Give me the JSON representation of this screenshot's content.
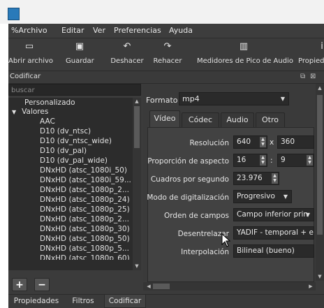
{
  "menubar": {
    "items": [
      {
        "label": "%Archivo"
      },
      {
        "label": "Editar"
      },
      {
        "label": "Ver"
      },
      {
        "label": "Preferencias"
      },
      {
        "label": "Ayuda"
      }
    ]
  },
  "toolbar": {
    "items": [
      {
        "label": "Abrir archivo",
        "icon": "folder-icon"
      },
      {
        "label": "Guardar",
        "icon": "save-icon"
      },
      {
        "label": "Deshacer",
        "icon": "undo-icon"
      },
      {
        "label": "Rehacer",
        "icon": "redo-icon"
      },
      {
        "label": "Medidores de Pico de Audio",
        "icon": "audio-meter-icon"
      },
      {
        "label": "Propied",
        "icon": "info-icon"
      }
    ]
  },
  "dock": {
    "title": "Codificar",
    "search_placeholder": "buscar"
  },
  "presets": {
    "groups": [
      {
        "label": "Personalizado"
      },
      {
        "label": "Valores"
      }
    ],
    "items": [
      "AAC",
      "D10 (dv_ntsc)",
      "D10 (dv_ntsc_wide)",
      "D10 (dv_pal)",
      "D10 (dv_pal_wide)",
      "DNxHD (atsc_1080i_50)",
      "DNxHD (atsc_1080i_59...",
      "DNxHD (atsc_1080p_2...",
      "DNxHD (atsc_1080p_24)",
      "DNxHD (atsc_1080p_25)",
      "DNxHD (atsc_1080p_2...",
      "DNxHD (atsc_1080p_30)",
      "DNxHD (atsc_1080p_50)",
      "DNxHD (atsc_1080p_5...",
      "DNxHD (atsc_1080p_60)"
    ]
  },
  "format": {
    "label": "Formato",
    "value": "mp4"
  },
  "tabs": [
    {
      "label": "Vídeo",
      "active": true
    },
    {
      "label": "Códec"
    },
    {
      "label": "Audio"
    },
    {
      "label": "Otro"
    }
  ],
  "video": {
    "resolution": {
      "label": "Resolución",
      "width": "640",
      "sep": "x",
      "height": "360"
    },
    "aspect": {
      "label": "Proporción de aspecto",
      "num": "16",
      "sep": ":",
      "den": "9"
    },
    "fps": {
      "label": "Cuadros por segundo",
      "value": "23.976"
    },
    "scan_mode": {
      "label": "Modo de digitalización",
      "value": "Progresivo"
    },
    "field_order": {
      "label": "Orden de campos",
      "value": "Campo inferior prin"
    },
    "deinterlacer": {
      "label": "Desentrelazar",
      "value": "YADIF - temporal + e"
    },
    "interpolation": {
      "label": "Interpolación",
      "value": "Bilineal (bueno)"
    }
  },
  "bottom_tabs": [
    {
      "label": "Propiedades"
    },
    {
      "label": "Filtros"
    },
    {
      "label": "Codificar",
      "active": true
    }
  ]
}
